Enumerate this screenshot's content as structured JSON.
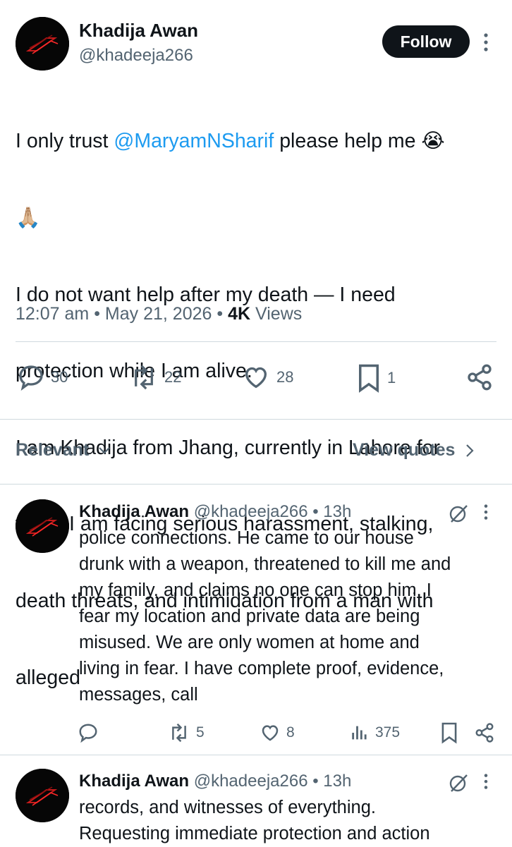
{
  "main_tweet": {
    "author_name": "Khadija Awan",
    "author_handle": "@khadeeja266",
    "follow_label": "Follow",
    "text_lines": [
      {
        "pre": "I only trust ",
        "mention": "@MaryamNSharif",
        "post": " please help me 😭"
      },
      {
        "pre": "🙏🏼",
        "mention": "",
        "post": ""
      },
      {
        "pre": "I do not want help after my death — I need",
        "mention": "",
        "post": ""
      },
      {
        "pre": "protection while I am alive.",
        "mention": "",
        "post": ""
      },
      {
        "pre": "I am Khadija from Jhang, currently in Lahore for",
        "mention": "",
        "post": ""
      },
      {
        "pre": "work. I am facing serious harassment, stalking,",
        "mention": "",
        "post": ""
      },
      {
        "pre": "death threats, and intimidation from a man with",
        "mention": "",
        "post": ""
      },
      {
        "pre": "alleged",
        "mention": "",
        "post": ""
      }
    ],
    "time": "12:07 am",
    "date": "May 21, 2026",
    "views_count": "4K",
    "views_label": "Views",
    "replies": "30",
    "reposts": "22",
    "likes": "28",
    "bookmarks": "1"
  },
  "sort": {
    "relevant_label": "Relevant",
    "view_quotes_label": "View quotes"
  },
  "replies": [
    {
      "author_name": "Khadija Awan",
      "author_handle": "@khadeeja266",
      "age": "13h",
      "text_lines": [
        "police connections. He came to our house",
        "drunk with a weapon, threatened to kill me and",
        "my family, and claims no one can stop him. I",
        "fear my location and private data are being",
        "misused. We are only women at home and",
        "living in fear. I have complete proof, evidence,",
        "messages, call"
      ],
      "replies": "",
      "reposts": "5",
      "likes": "8",
      "views": "375"
    },
    {
      "author_name": "Khadija Awan",
      "author_handle": "@khadeeja266",
      "age": "13h",
      "text_lines": [
        "records, and witnesses of everything.",
        "Requesting immediate protection and action"
      ]
    }
  ],
  "separator": "•",
  "colors": {
    "text": "#0f1419",
    "muted": "#536471",
    "link": "#1d9bf0",
    "divider": "#cfd9de"
  },
  "icons": [
    "more-icon",
    "reply-icon",
    "repost-icon",
    "like-icon",
    "bookmark-icon",
    "share-icon",
    "chevron-down-icon",
    "chevron-right-icon",
    "grok-icon",
    "views-icon"
  ]
}
